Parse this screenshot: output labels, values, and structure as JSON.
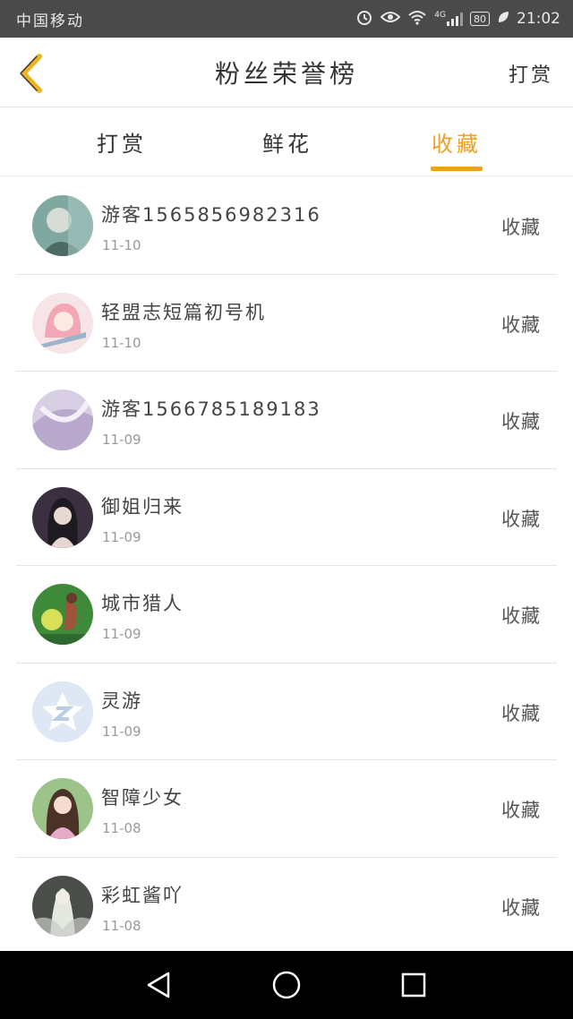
{
  "status_bar": {
    "carrier": "中国移动",
    "network": "4G",
    "battery": "80",
    "time": "21:02"
  },
  "header": {
    "title": "粉丝荣誉榜",
    "right_action": "打赏"
  },
  "tabs": [
    {
      "label": "打赏",
      "active": false
    },
    {
      "label": "鲜花",
      "active": false
    },
    {
      "label": "收藏",
      "active": true
    }
  ],
  "accent_color": "#f0a020",
  "fans": [
    {
      "name": "游客1565856982316",
      "date": "11-10",
      "action": "收藏"
    },
    {
      "name": "轻盟志短篇初号机",
      "date": "11-10",
      "action": "收藏"
    },
    {
      "name": "游客1566785189183",
      "date": "11-09",
      "action": "收藏"
    },
    {
      "name": "御姐归来",
      "date": "11-09",
      "action": "收藏"
    },
    {
      "name": "城市猎人",
      "date": "11-09",
      "action": "收藏"
    },
    {
      "name": "灵游",
      "date": "11-09",
      "action": "收藏"
    },
    {
      "name": "智障少女",
      "date": "11-08",
      "action": "收藏"
    },
    {
      "name": "彩虹酱吖",
      "date": "11-08",
      "action": "收藏"
    }
  ],
  "system_nav": {
    "back": "back-icon",
    "home": "home-icon",
    "recents": "recents-icon"
  }
}
